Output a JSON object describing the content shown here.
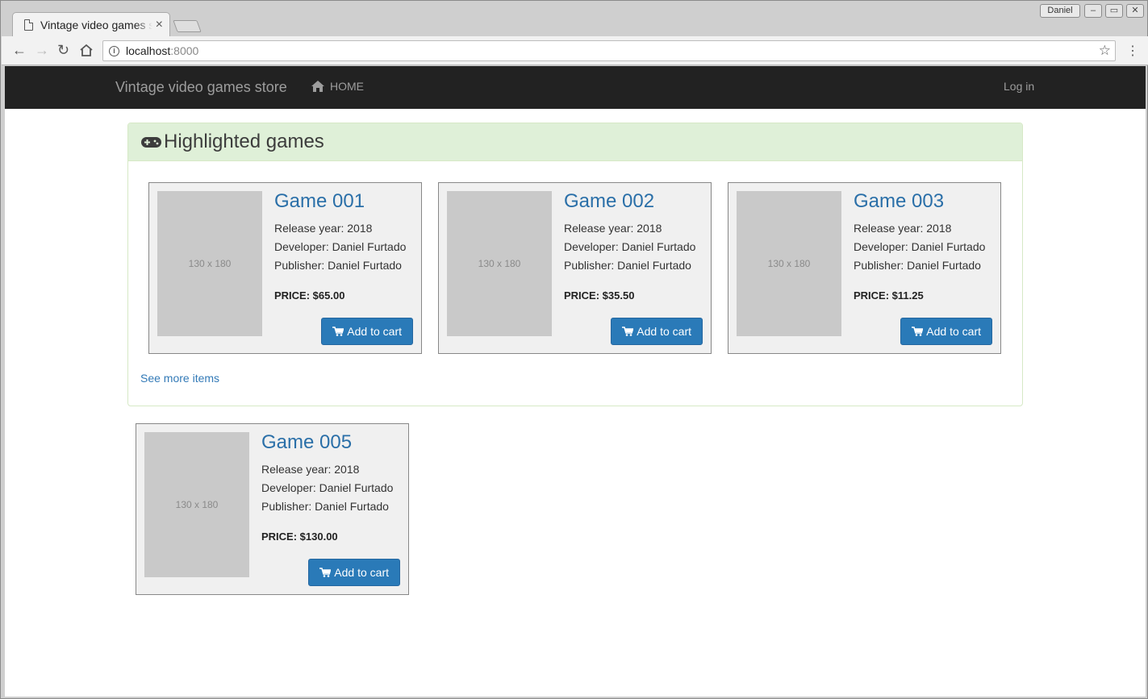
{
  "browser": {
    "tab_title": "Vintage video games store",
    "url_host": "localhost",
    "url_port": ":8000",
    "user_name": "Daniel",
    "close_glyph": "×",
    "back_glyph": "←",
    "forward_glyph": "→",
    "reload_glyph": "↻",
    "star_glyph": "☆",
    "menu_glyph": "⋮",
    "minimize_glyph": "–",
    "maximize_glyph": "▭",
    "window_close_glyph": "✕"
  },
  "navbar": {
    "brand": "Vintage video games store",
    "home_label": "HOME",
    "login_label": "Log in",
    "home_icon": "home-icon"
  },
  "highlighted": {
    "title": "Highlighted games",
    "icon": "gamepad-icon",
    "see_more": "See more items",
    "games": [
      {
        "title": "Game 001",
        "release": "Release year: 2018",
        "developer": "Developer: Daniel Furtado",
        "publisher": "Publisher: Daniel Furtado",
        "price": "PRICE: $65.00",
        "thumb": "130 x 180",
        "button": "Add to cart"
      },
      {
        "title": "Game 002",
        "release": "Release year: 2018",
        "developer": "Developer: Daniel Furtado",
        "publisher": "Publisher: Daniel Furtado",
        "price": "PRICE: $35.50",
        "thumb": "130 x 180",
        "button": "Add to cart"
      },
      {
        "title": "Game 003",
        "release": "Release year: 2018",
        "developer": "Developer: Daniel Furtado",
        "publisher": "Publisher: Daniel Furtado",
        "price": "PRICE: $11.25",
        "thumb": "130 x 180",
        "button": "Add to cart"
      }
    ]
  },
  "other_games": [
    {
      "title": "Game 005",
      "release": "Release year: 2018",
      "developer": "Developer: Daniel Furtado",
      "publisher": "Publisher: Daniel Furtado",
      "price": "PRICE: $130.00",
      "thumb": "130 x 180",
      "button": "Add to cart"
    }
  ],
  "colors": {
    "navbar_bg": "#222222",
    "panel_heading_bg": "#dff0d8",
    "link": "#337ab7",
    "button_bg": "#2a7ab8"
  }
}
